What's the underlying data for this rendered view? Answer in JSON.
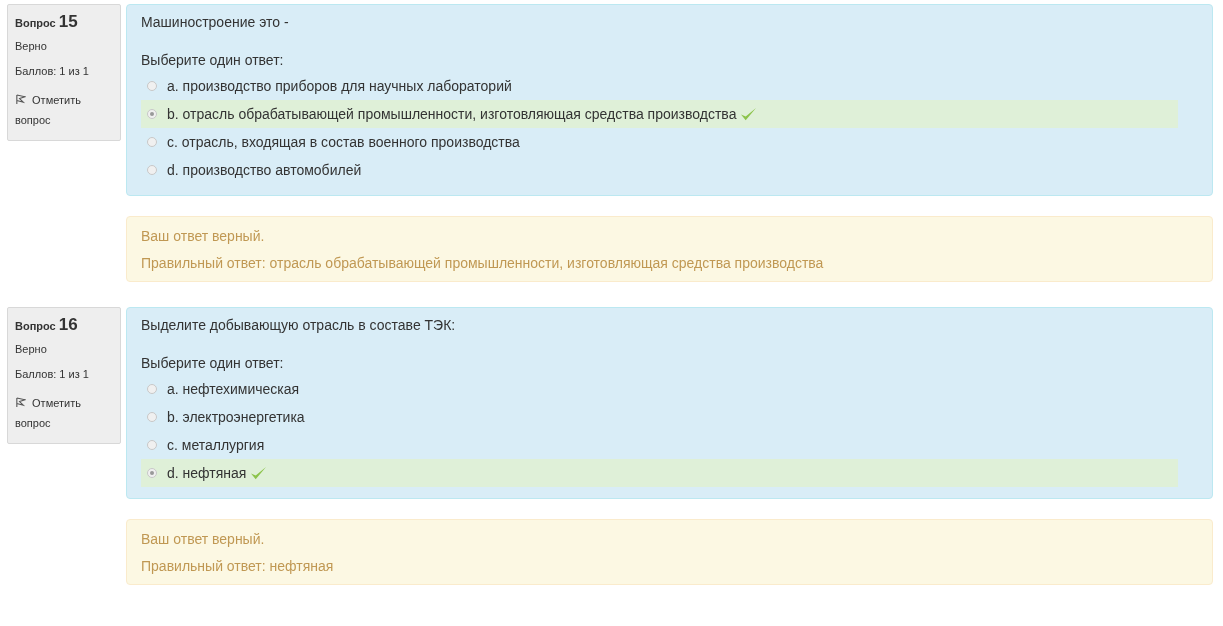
{
  "questions": [
    {
      "label": "Вопрос",
      "number": "15",
      "state": "Верно",
      "grade": "Баллов: 1 из 1",
      "flag": "Отметить вопрос",
      "text": "Машиностроение это -",
      "prompt": "Выберите один ответ:",
      "options": [
        {
          "label": "a. производство приборов для научных лабораторий",
          "selected": false,
          "correct": false
        },
        {
          "label": "b. отрасль обрабатывающей промышленности, изготовляющая средства производства",
          "selected": true,
          "correct": true
        },
        {
          "label": "c. отрасль, входящая в состав военного производства",
          "selected": false,
          "correct": false
        },
        {
          "label": "d. производство автомобилей",
          "selected": false,
          "correct": false
        }
      ],
      "feedback": [
        "Ваш ответ верный.",
        "Правильный ответ: отрасль обрабатывающей промышленности, изготовляющая средства производства"
      ]
    },
    {
      "label": "Вопрос",
      "number": "16",
      "state": "Верно",
      "grade": "Баллов: 1 из 1",
      "flag": "Отметить вопрос",
      "text": "Выделите добывающую отрасль в составе ТЭК:",
      "prompt": "Выберите один ответ:",
      "options": [
        {
          "label": "a. нефтехимическая",
          "selected": false,
          "correct": false
        },
        {
          "label": "b. электроэнергетика",
          "selected": false,
          "correct": false
        },
        {
          "label": "c. металлургия",
          "selected": false,
          "correct": false
        },
        {
          "label": "d. нефтяная",
          "selected": true,
          "correct": true
        }
      ],
      "feedback": [
        "Ваш ответ верный.",
        "Правильный ответ: нефтяная"
      ]
    }
  ]
}
